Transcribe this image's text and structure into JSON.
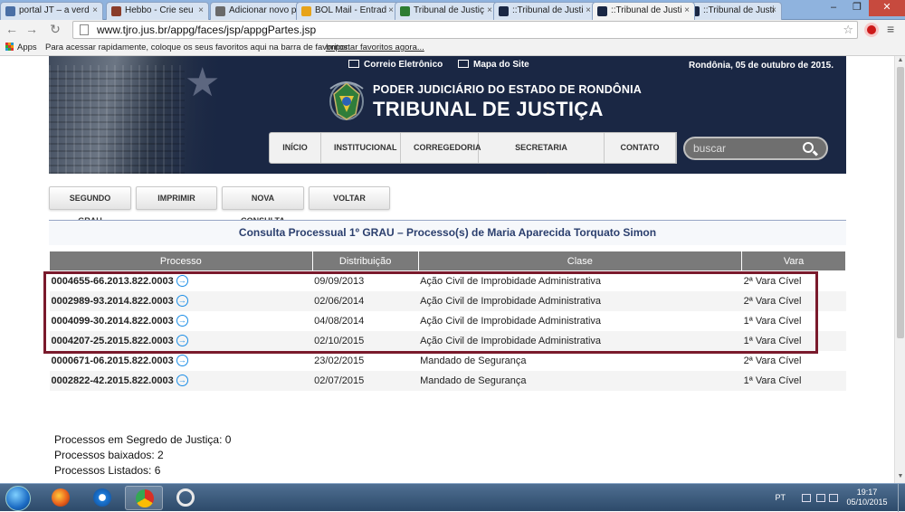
{
  "browser": {
    "tabs": [
      {
        "label": "portal JT – a verd",
        "favicon_color": "#4a6fa5",
        "active": false
      },
      {
        "label": "Hebbo - Crie seu",
        "favicon_color": "#8a3d2a",
        "active": false
      },
      {
        "label": "Adicionar novo p",
        "favicon_color": "#6a6a6a",
        "active": false
      },
      {
        "label": "BOL Mail - Entrad",
        "favicon_color": "#e7a31a",
        "active": false
      },
      {
        "label": "Tribunal de Justiç",
        "favicon_color": "#2e7d32",
        "active": false
      },
      {
        "label": "::Tribunal de Justi",
        "favicon_color": "#1a2744",
        "active": false
      },
      {
        "label": "::Tribunal de Justi",
        "favicon_color": "#1a2744",
        "active": true
      },
      {
        "label": "::Tribunal de Justi",
        "favicon_color": "#1a2744",
        "active": false
      }
    ],
    "url": "www.tjro.jus.br/appg/faces/jsp/appgPartes.jsp",
    "bookmarks": {
      "apps": "Apps",
      "hint": "Para acessar rapidamente, coloque os seus favoritos aqui na barra de favoritos.",
      "import": "Importar favoritos agora..."
    }
  },
  "header": {
    "email_link": "Correio Eletrônico",
    "sitemap_link": "Mapa do Site",
    "date": "Rondônia, 05 de outubro de 2015.",
    "brand_line1": "PODER JUDICIÁRIO DO ESTADO DE RONDÔNIA",
    "brand_line2": "TRIBUNAL DE JUSTIÇA",
    "nav": [
      "INÍCIO",
      "INSTITUCIONAL",
      "CORREGEDORIA",
      "SECRETARIA JUDICIÁRIA",
      "CONTATO"
    ],
    "search_placeholder": "buscar"
  },
  "actions": [
    "SEGUNDO GRAU",
    "IMPRIMIR",
    "NOVA CONSULTA",
    "VOLTAR"
  ],
  "heading": "Consulta Processual 1º GRAU – Processo(s) de Maria Aparecida Torquato Simon",
  "table": {
    "columns": [
      "Processo",
      "Distribuição",
      "Clase",
      "Vara"
    ],
    "rows": [
      [
        "0004655-66.2013.822.0003",
        "09/09/2013",
        "Ação Civil de Improbidade Administrativa",
        "2ª Vara Cível"
      ],
      [
        "0002989-93.2014.822.0003",
        "02/06/2014",
        "Ação Civil de Improbidade Administrativa",
        "2ª Vara Cível"
      ],
      [
        "0004099-30.2014.822.0003",
        "04/08/2014",
        "Ação Civil de Improbidade Administrativa",
        "1ª Vara Cível"
      ],
      [
        "0004207-25.2015.822.0003",
        "02/10/2015",
        "Ação Civil de Improbidade Administrativa",
        "1ª Vara Cível"
      ],
      [
        "0000671-06.2015.822.0003",
        "23/02/2015",
        "Mandado de Segurança",
        "2ª Vara Cível"
      ],
      [
        "0002822-42.2015.822.0003",
        "02/07/2015",
        "Mandado de Segurança",
        "1ª Vara Cível"
      ]
    ]
  },
  "stats": [
    "Processos em Segredo de Justiça: 0",
    "Processos baixados: 2",
    "Processos Listados: 6"
  ],
  "taskbar": {
    "lang": "PT",
    "time": "19:17",
    "date": "05/10/2015"
  },
  "colors": {
    "banner": "#1a2744",
    "highlight_border": "#7a1a2c",
    "table_header": "#7a7a7a",
    "heading_text": "#2b3f6e"
  }
}
